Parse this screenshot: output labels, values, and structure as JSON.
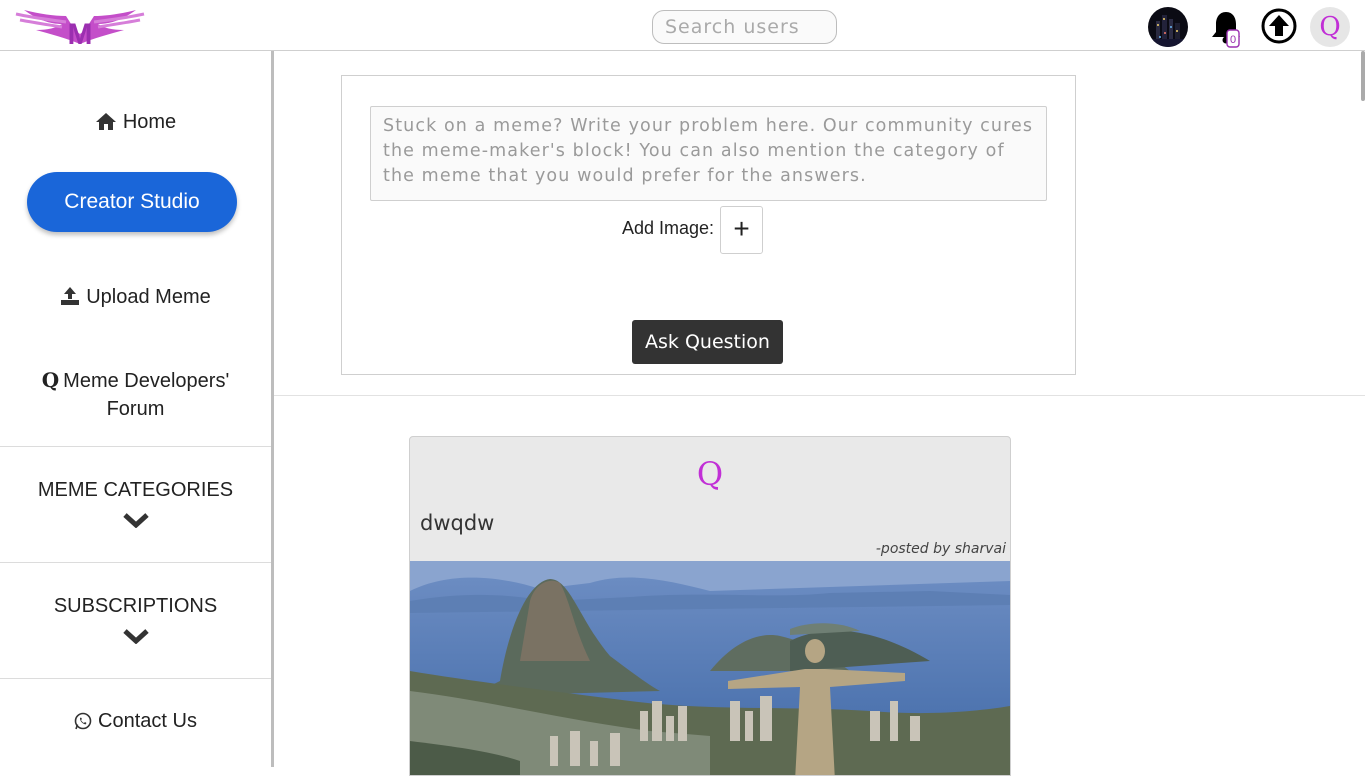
{
  "header": {
    "search_placeholder": "Search users",
    "notification_count": "0",
    "profile_initial": "Q",
    "accent_color": "#c12fd6"
  },
  "sidebar": {
    "home": "Home",
    "creator_studio": "Creator Studio",
    "upload_meme": "Upload Meme",
    "forum_line1": "Meme Developers'",
    "forum_line2": "Forum",
    "forum_icon": "Q",
    "meme_categories": "MEME CATEGORIES",
    "subscriptions": "SUBSCRIPTIONS",
    "contact_us": "Contact Us",
    "creator_color": "#1a66d9"
  },
  "ask": {
    "placeholder": "Stuck on a meme? Write your problem here. Our community cures the meme-maker's block! You can also mention the category of the meme that you would prefer for the answers.",
    "add_image_label": "Add Image:",
    "add_symbol": "+",
    "ask_button": "Ask Question"
  },
  "post": {
    "icon_letter": "Q",
    "title": "dwqdw",
    "posted_by": "-posted by sharvai"
  }
}
